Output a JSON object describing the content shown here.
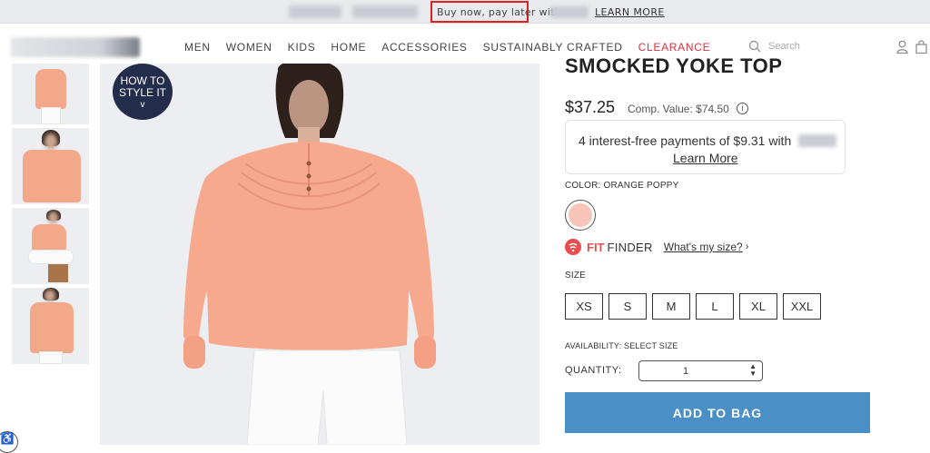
{
  "promo": {
    "text": "Buy now, pay later with",
    "link": "LEARN MORE"
  },
  "nav": {
    "items": [
      "MEN",
      "WOMEN",
      "KIDS",
      "HOME",
      "ACCESSORIES",
      "SUSTAINABLY CRAFTED",
      "CLEARANCE"
    ],
    "search_placeholder": "Search"
  },
  "gallery": {
    "style_badge_line1": "HOW TO",
    "style_badge_line2": "STYLE IT",
    "style_badge_line3": "v"
  },
  "product": {
    "title": "SMOCKED YOKE TOP",
    "price": "$37.25",
    "comp_value": "Comp. Value: $74.50",
    "info_icon": "i",
    "payments_text": "4 interest-free payments of $9.31 with",
    "payments_link": "Learn More",
    "color_label": "COLOR: ORANGE POPPY",
    "fit_bold": "FIT",
    "fit_light": "FINDER",
    "fit_link": "What's my size?",
    "fit_chevron": "›",
    "size_label": "SIZE",
    "sizes": [
      "XS",
      "S",
      "M",
      "L",
      "XL",
      "XXL"
    ],
    "availability": "AVAILABILITY: SELECT SIZE",
    "quantity_label": "QUANTITY:",
    "quantity_value": "1",
    "add_to_bag": "ADD TO BAG"
  },
  "colors": {
    "accent_button": "#4a8fc6",
    "clearance": "#e0303c",
    "badge": "#232d4b",
    "swatch": "#f8c5b8"
  }
}
